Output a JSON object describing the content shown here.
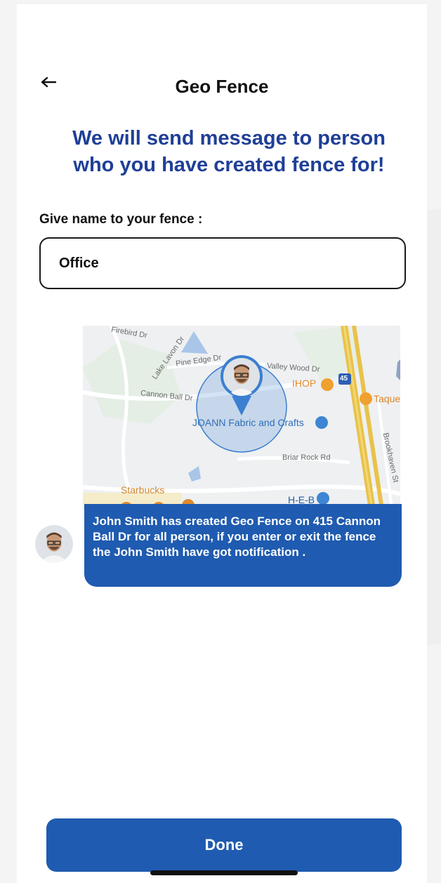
{
  "header": {
    "title": "Geo Fence",
    "back_icon": "arrow-left-icon"
  },
  "headline": "We will send message to person\nwho you have created fence for!",
  "form": {
    "label": "Give name to your fence :",
    "fence_name": "Office"
  },
  "map": {
    "streets": [
      "Firebird Dr",
      "Lake Lavon Dr",
      "Pine Edge Dr",
      "Valley Wood Dr",
      "Cannon Ball Dr",
      "Briar Rock Rd",
      "Brookhaven St"
    ],
    "pois": [
      "IHOP",
      "Taque",
      "JOANN Fabric and Crafts",
      "Starbucks",
      "H-E-B"
    ],
    "highway_shield": "45",
    "fence_color": "#3b7fd0"
  },
  "message": {
    "text": "John Smith has created Geo Fence on 415 Cannon Ball Dr for all person, if you enter or exit the fence  the John Smith have got notification ."
  },
  "actions": {
    "done_label": "Done"
  },
  "colors": {
    "primary": "#1f5bb0",
    "headline": "#1f3f97"
  }
}
